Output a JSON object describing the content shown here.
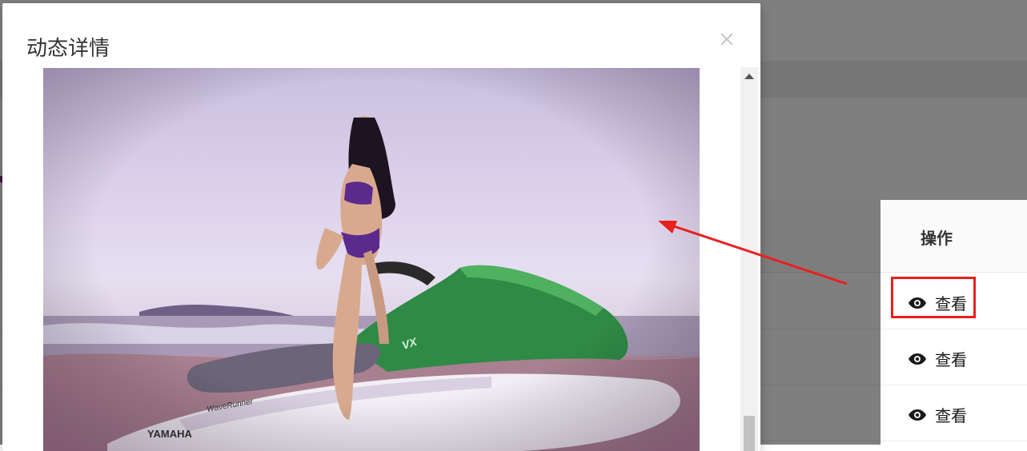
{
  "modal": {
    "title": "动态详情",
    "close_icon": "close-icon"
  },
  "table": {
    "action_column_header": "操作",
    "rows": [
      {
        "action_label": "查看",
        "action_icon": "eye-icon"
      },
      {
        "action_label": "查看",
        "action_icon": "eye-icon"
      },
      {
        "action_label": "查看",
        "action_icon": "eye-icon"
      }
    ]
  },
  "photo": {
    "watermark_text": "YAMAHA",
    "model_text": "WaveRunner",
    "hull_text": "VX"
  },
  "annotation": {
    "highlight_color": "#e8201e"
  }
}
